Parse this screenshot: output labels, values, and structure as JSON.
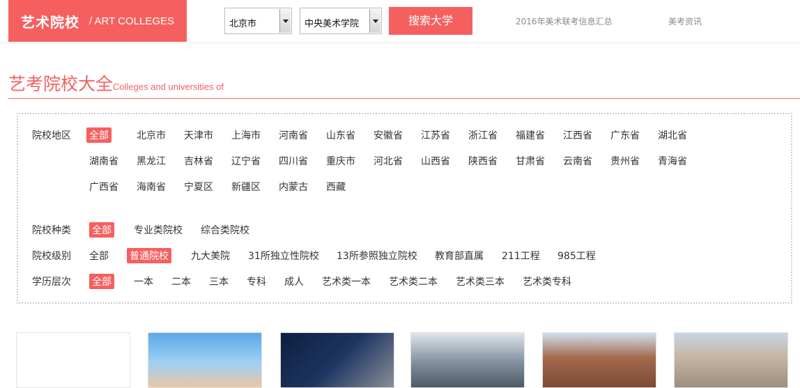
{
  "brand": {
    "cn": "艺术院校",
    "en": "/ ART COLLEGES"
  },
  "search": {
    "city": "北京市",
    "school": "中央美术学院",
    "button": "搜索大学"
  },
  "top_links": [
    "2016年美术联考信息汇总",
    "美考资讯"
  ],
  "heading": {
    "cn": "艺考院校大全",
    "en": "Colleges and universities of"
  },
  "filters": {
    "region": {
      "label": "院校地区",
      "rows": [
        [
          "全部",
          "北京市",
          "天津市",
          "上海市",
          "河南省",
          "山东省",
          "安徽省",
          "江苏省",
          "浙江省",
          "福建省",
          "江西省",
          "广东省",
          "湖北省"
        ],
        [
          "湖南省",
          "黑龙江",
          "吉林省",
          "辽宁省",
          "四川省",
          "重庆市",
          "河北省",
          "山西省",
          "陕西省",
          "甘肃省",
          "云南省",
          "贵州省",
          "青海省"
        ],
        [
          "广西省",
          "海南省",
          "宁夏区",
          "新疆区",
          "内蒙古",
          "西藏"
        ]
      ],
      "active": "全部"
    },
    "type": {
      "label": "院校种类",
      "options": [
        "全部",
        "专业类院校",
        "综合类院校"
      ],
      "active": "全部"
    },
    "level": {
      "label": "院校级别",
      "options": [
        "全部",
        "普通院校",
        "九大美院",
        "31所独立性院校",
        "13所参照独立院校",
        "教育部直属",
        "211工程",
        "985工程"
      ],
      "active": "普通院校"
    },
    "degree": {
      "label": "学历层次",
      "options": [
        "全部",
        "一本",
        "二本",
        "三本",
        "专科",
        "成人",
        "艺术类一本",
        "艺术类二本",
        "艺术类三本",
        "艺术类专科"
      ],
      "active": "全部"
    }
  },
  "colors": {
    "accent": "#f5605f"
  }
}
